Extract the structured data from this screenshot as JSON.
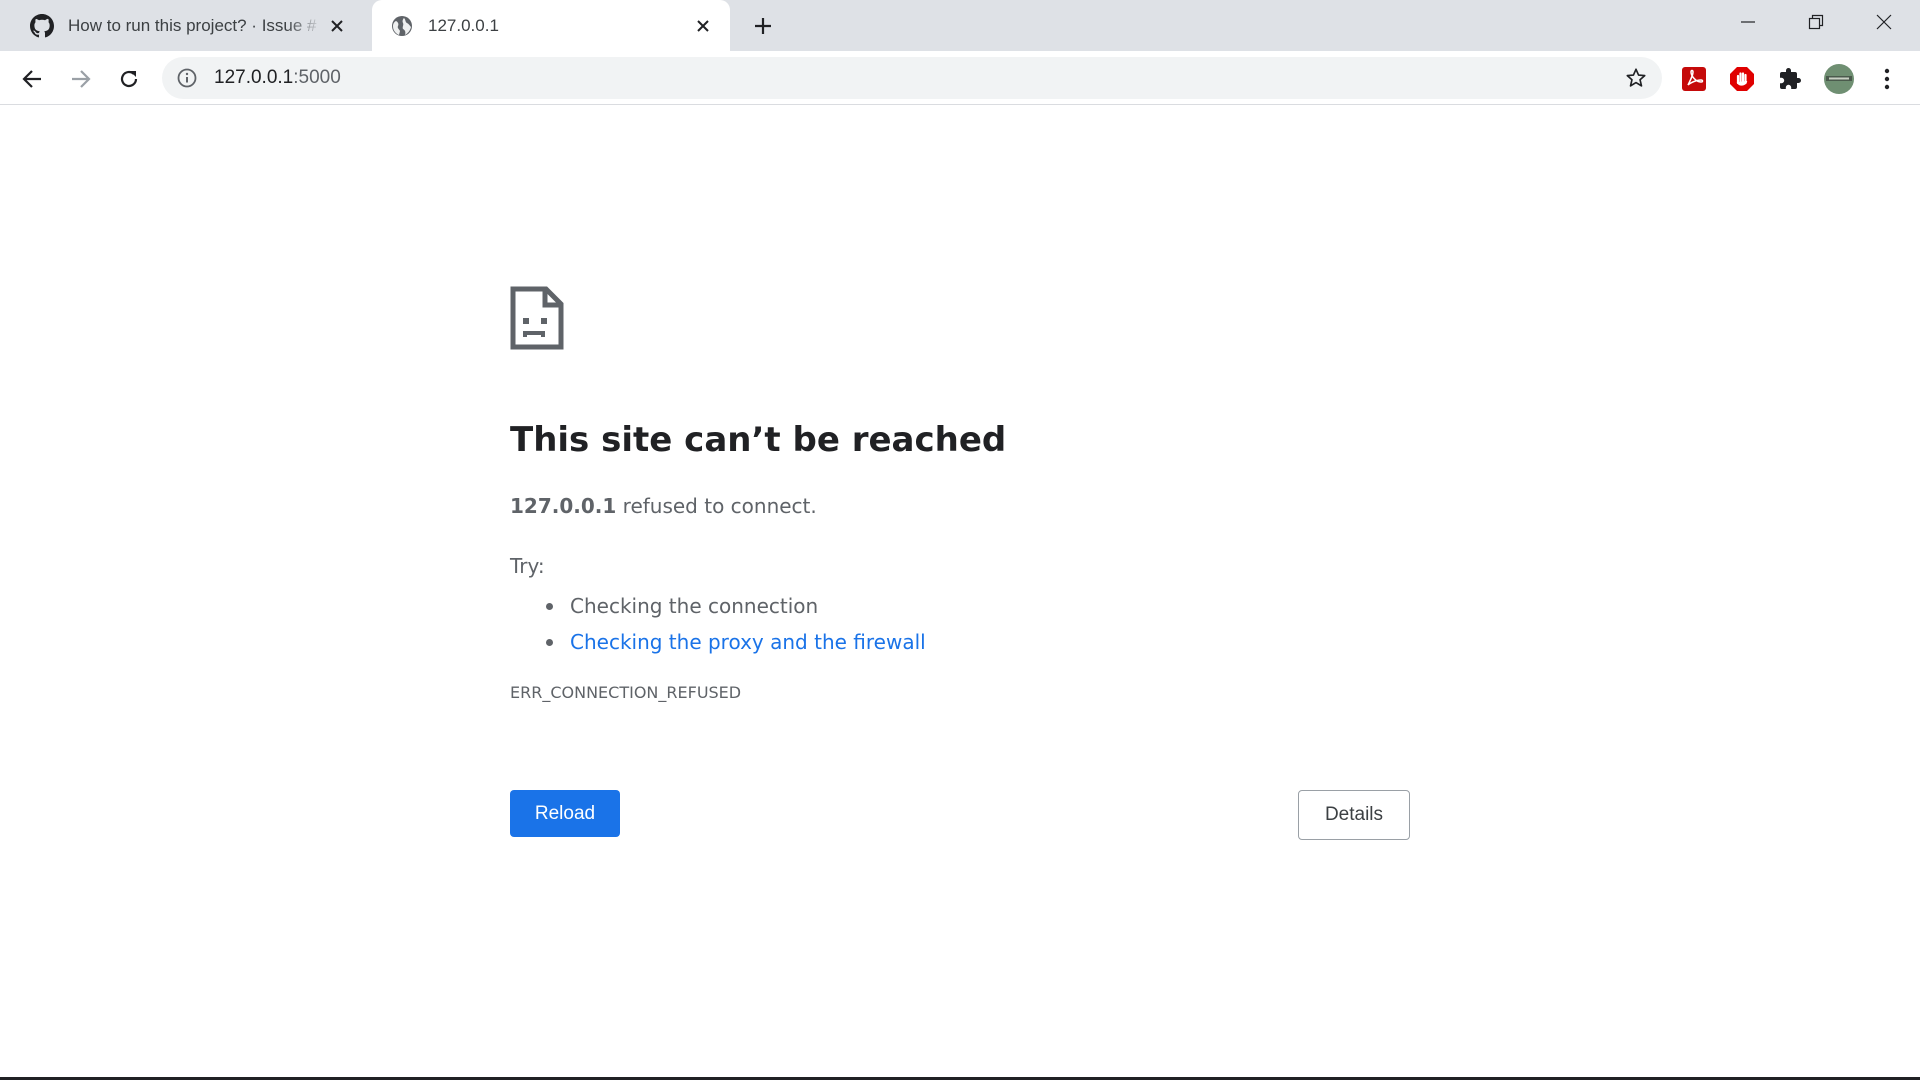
{
  "browser": {
    "tabs": [
      {
        "title": "How to run this project? · Issue #",
        "favicon": "github-icon",
        "active": false
      },
      {
        "title": "127.0.0.1",
        "favicon": "globe-icon",
        "active": true
      }
    ],
    "omnibox": {
      "host": "127.0.0.1",
      "port": ":5000",
      "info_icon": "info-icon"
    },
    "extensions": [
      "adobe-acrobat-icon",
      "adblock-icon",
      "puzzle-icon"
    ],
    "colors": {
      "tabstrip": "#dee1e6",
      "acrobat": "#c50a0a",
      "adblock": "#e00000"
    }
  },
  "error_page": {
    "icon": "sad-document-icon",
    "title": "This site can’t be reached",
    "host_bold": "127.0.0.1",
    "message": " refused to connect.",
    "try_label": "Try:",
    "suggestions": [
      {
        "text": "Checking the connection",
        "is_link": false
      },
      {
        "text": "Checking the proxy and the firewall",
        "is_link": true
      }
    ],
    "error_code": "ERR_CONNECTION_REFUSED",
    "reload_label": "Reload",
    "details_label": "Details",
    "colors": {
      "primary": "#1a73e8",
      "text": "#5f6368",
      "title": "#202124"
    }
  }
}
